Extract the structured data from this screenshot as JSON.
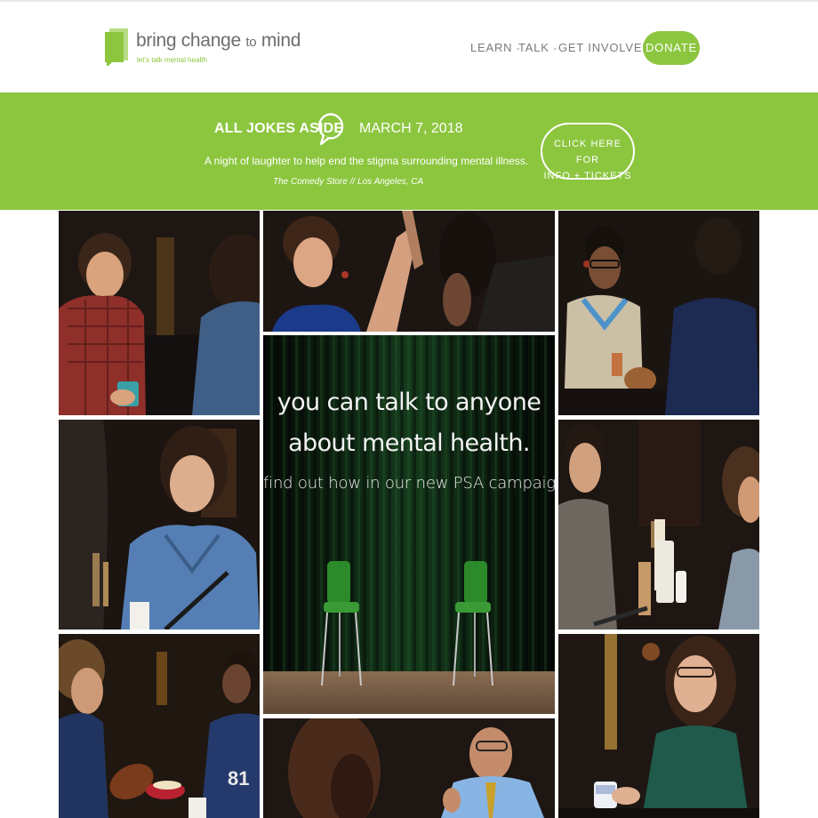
{
  "header": {
    "logo": {
      "name_main": "bring change",
      "name_to": "to",
      "name_end": "mind",
      "tagline": "let's talk mental health"
    },
    "nav": [
      {
        "label": "LEARN",
        "chevron": "chevron-down-icon"
      },
      {
        "label": "TALK",
        "chevron": "chevron-down-icon"
      },
      {
        "label": "GET INVOLVED",
        "chevron": "chevron-down-icon"
      }
    ],
    "donate_label": "DONATE"
  },
  "banner": {
    "title": "ALL JOKES ASIDE",
    "date": "MARCH 7, 2018",
    "description": "A night of laughter to help end the stigma surrounding mental illness.",
    "venue": "The Comedy Store // Los Angeles, CA",
    "ticket_line1": "CLICK HERE FOR",
    "ticket_line2": "INFO + TICKETS"
  },
  "psa": {
    "line1": "you can talk to anyone",
    "line2": "about mental health.",
    "line3": "find out how in our new PSA campaign."
  },
  "colors": {
    "brand_green": "#8cc63f",
    "nav_gray": "#7a7a7a",
    "psa_curtain": "#0f2a14"
  }
}
